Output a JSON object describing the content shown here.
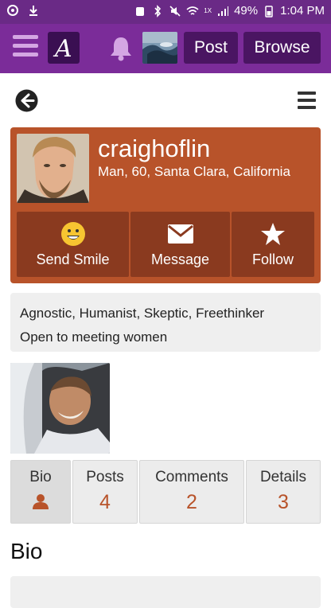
{
  "status_bar": {
    "battery": "49%",
    "time": "1:04 PM",
    "signal_label": "1X"
  },
  "topbar": {
    "logo_letter": "A",
    "post_label": "Post",
    "browse_label": "Browse"
  },
  "profile": {
    "username": "craighoflin",
    "info": "Man, 60, Santa Clara, California",
    "actions": {
      "send_smile": "Send Smile",
      "message": "Message",
      "follow": "Follow"
    }
  },
  "beliefs": {
    "line1": "Agnostic, Humanist, Skeptic, Freethinker",
    "line2": "Open to meeting women"
  },
  "tabs": {
    "bio": {
      "label": "Bio"
    },
    "posts": {
      "label": "Posts",
      "count": "4"
    },
    "comments": {
      "label": "Comments",
      "count": "2"
    },
    "details": {
      "label": "Details",
      "count": "3"
    }
  },
  "bio": {
    "heading": "Bio"
  },
  "colors": {
    "topbar": "#7b2c99",
    "accent": "#b8532a",
    "action_bg": "#8a3a1f"
  }
}
